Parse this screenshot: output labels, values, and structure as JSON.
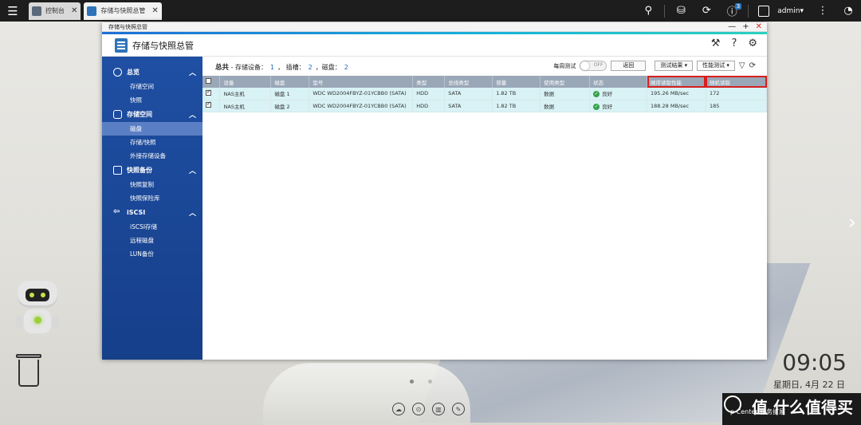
{
  "taskbar": {
    "tabs": [
      {
        "label": "控制台"
      },
      {
        "label": "存储与快照总管"
      }
    ],
    "notification_badge": "3",
    "user": "admin"
  },
  "window": {
    "title": "存储与快照总管",
    "app_title": "存储与快照总管"
  },
  "sidebar": {
    "groups": [
      {
        "label": "总览",
        "items": [
          "存储空间",
          "快照"
        ]
      },
      {
        "label": "存储空间",
        "items": [
          "磁盘",
          "存储/快照",
          "外接存储设备"
        ]
      },
      {
        "label": "快照备份",
        "items": [
          "快照复制",
          "快照保险库"
        ]
      },
      {
        "label": "iSCSI",
        "items": [
          "iSCSI存储",
          "远程磁盘",
          "LUN备份"
        ]
      }
    ]
  },
  "summary": {
    "prefix": "总共",
    "text1": "- 存储设备：",
    "devices": "1",
    "text2": "， 插槽：",
    "slots": "2",
    "text3": "，磁盘：",
    "disks": "2"
  },
  "toolbar": {
    "weekly_test_label": "每周测试",
    "toggle_state": "OFF",
    "back_label": "返回",
    "test_results_label": "测试结果",
    "performance_test_label": "性能测试"
  },
  "table": {
    "headers": [
      "设备",
      "磁盘",
      "型号",
      "类型",
      "总线类型",
      "容量",
      "使用类型",
      "状态",
      "顺序读取性能",
      "随机读取"
    ],
    "rows": [
      {
        "device": "NAS主机",
        "disk": "磁盘 1",
        "model": "WDC WD2004FBYZ-01YCBB0 (SATA)",
        "type": "HDD",
        "bus": "SATA",
        "capacity": "1.82 TB",
        "usage": "数据",
        "status": "良好",
        "seq_read": "195.26 MB/sec",
        "rand_read": "172"
      },
      {
        "device": "NAS主机",
        "disk": "磁盘 2",
        "model": "WDC WD2004FBYZ-01YCBB0 (SATA)",
        "type": "HDD",
        "bus": "SATA",
        "capacity": "1.82 TB",
        "usage": "数据",
        "status": "良好",
        "seq_read": "188.28 MB/sec",
        "rand_read": "185"
      }
    ]
  },
  "desktop": {
    "time": "09:05",
    "date": "星期日, 4月 22 日",
    "notify_text": "p Center  服务扩展",
    "watermark": "值 什么值得买"
  }
}
